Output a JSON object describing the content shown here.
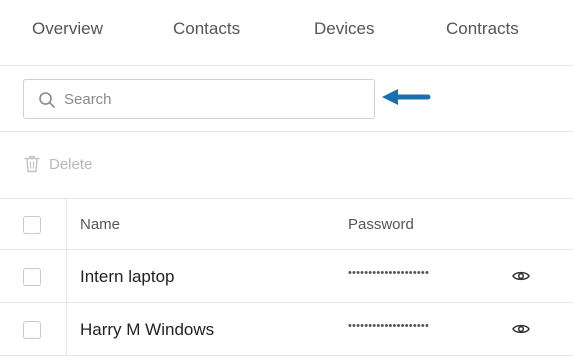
{
  "tabs": [
    {
      "label": "Overview"
    },
    {
      "label": "Contacts"
    },
    {
      "label": "Devices"
    },
    {
      "label": "Contracts"
    }
  ],
  "search": {
    "placeholder": "Search",
    "value": "",
    "icon": "search-icon"
  },
  "toolbar": {
    "delete_label": "Delete",
    "delete_icon": "trash-icon"
  },
  "table": {
    "columns": [
      "Name",
      "Password"
    ],
    "rows": [
      {
        "name": "Intern laptop",
        "password": "••••••••••••••••••••"
      },
      {
        "name": "Harry M Windows",
        "password": "••••••••••••••••••••"
      }
    ]
  },
  "colors": {
    "arrow": "#1a6fb0",
    "border": "#e6e6e6",
    "muted": "#b8b8b8"
  }
}
